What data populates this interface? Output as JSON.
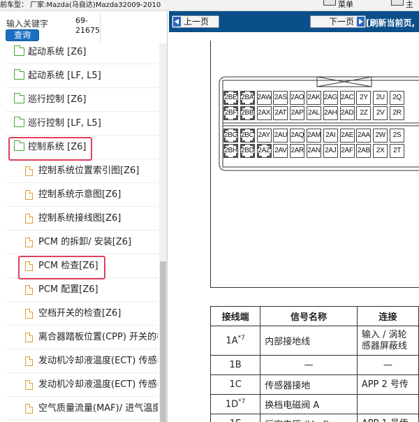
{
  "topbar": {
    "vehicle": "前车型： 厂家:Mazda(马自达)Mazda32009-2010",
    "btn1": "菜单",
    "btn2": "主"
  },
  "search": {
    "label": "输入关键字",
    "value": "69-\n21675",
    "button": "查询"
  },
  "tree": [
    {
      "label": "起动系统 [Z6]",
      "type": "folder",
      "level": 0
    },
    {
      "label": "起动系统 [LF, L5]",
      "type": "folder",
      "level": 0
    },
    {
      "label": "巡行控制 [Z6]",
      "type": "folder",
      "level": 0
    },
    {
      "label": "巡行控制 [LF, L5]",
      "type": "folder",
      "level": 0
    },
    {
      "label": "控制系统 [Z6]",
      "type": "folder-open",
      "level": 0,
      "highlighted": true
    },
    {
      "label": "控制系统位置索引图[Z6]",
      "type": "doc",
      "level": 1
    },
    {
      "label": "控制系统示意图[Z6]",
      "type": "doc",
      "level": 1
    },
    {
      "label": "控制系统接线图[Z6]",
      "type": "doc",
      "level": 1
    },
    {
      "label": "PCM 的拆卸/ 安装[Z6]",
      "type": "doc",
      "level": 1
    },
    {
      "label": "PCM 检查[Z6]",
      "type": "doc",
      "level": 1,
      "highlighted": true
    },
    {
      "label": "PCM 配置[Z6]",
      "type": "doc",
      "level": 1
    },
    {
      "label": "空档开关的检查[Z6]",
      "type": "doc",
      "level": 1
    },
    {
      "label": "离合器踏板位置(CPP) 开关的检查[Z6]",
      "type": "doc",
      "level": 1
    },
    {
      "label": "发动机冷却液温度(ECT) 传感器的检查[Z6]",
      "type": "doc",
      "level": 1
    },
    {
      "label": "发动机冷却液温度(ECT) 传感器的拆卸/安装[Z6]",
      "type": "doc",
      "level": 1
    },
    {
      "label": "空气质量流量(MAF)/ 进气温度(IAT) 传感器[Z6]",
      "type": "doc",
      "level": 1
    }
  ],
  "nav": {
    "prev": "上一页",
    "next": "下一页",
    "refresh": "[刷新当前页,"
  },
  "connector": {
    "rows": [
      [
        "2BE",
        "2BA",
        "2AW",
        "2AS",
        "2AO",
        "2AK",
        "2AG",
        "2AC",
        "2Y",
        "2U",
        "2Q"
      ],
      [
        "2BF",
        "2BB",
        "2AX",
        "2AT",
        "2AP",
        "2AL",
        "2AH",
        "2AD",
        "2Z",
        "2V",
        "2R"
      ],
      [
        "2BG",
        "2BC",
        "2AY",
        "2AU",
        "2AQ",
        "2AM",
        "2AI",
        "2AE",
        "2AA",
        "2W",
        "2S"
      ],
      [
        "2BH",
        "2BD",
        "2AZ",
        "2AV",
        "2AR",
        "2AN",
        "2AJ",
        "2AF",
        "2AB",
        "2X",
        "2T"
      ]
    ]
  },
  "pin_table": {
    "headers": [
      "接线端",
      "信号名称",
      "连接"
    ],
    "rows": [
      {
        "pin": "1A",
        "sup": "*7",
        "signal": "内部接地线",
        "conn": "输入 / 涡轮\n感器屏蔽线"
      },
      {
        "pin": "1B",
        "sup": "",
        "signal": "—",
        "conn": "—"
      },
      {
        "pin": "1C",
        "sup": "",
        "signal": "传感器接地",
        "conn": "APP 2 号传"
      },
      {
        "pin": "1D",
        "sup": "*7",
        "signal": "换档电磁阀 A",
        "conn": ""
      },
      {
        "pin": "1E",
        "sup": "",
        "signal": "恒定电压 (Vref)",
        "conn": "APP 1 号传"
      }
    ]
  }
}
